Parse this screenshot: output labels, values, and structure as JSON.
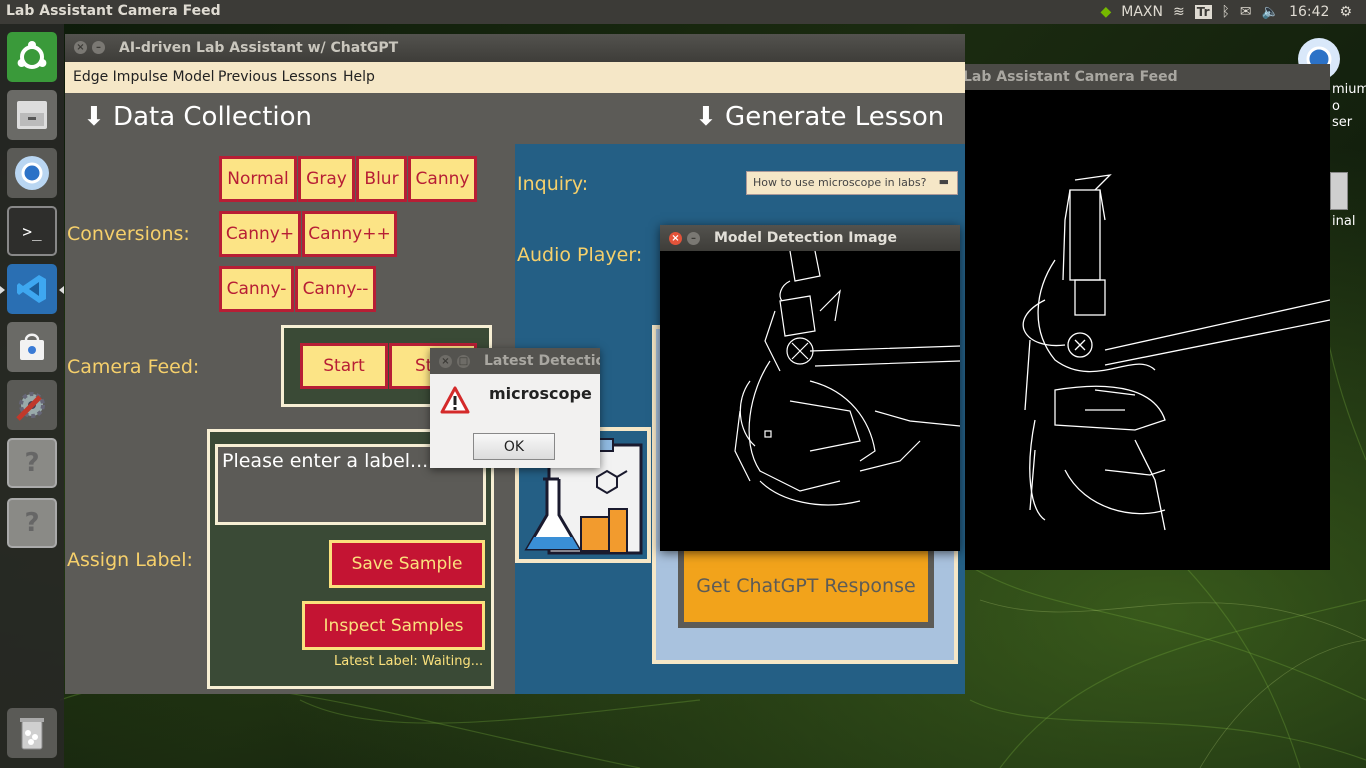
{
  "topbar": {
    "title": "Lab Assistant Camera Feed",
    "tray": {
      "user": "MAXN",
      "keyboard": "Tr",
      "time": "16:42"
    }
  },
  "desktop": {
    "partial_labels": [
      "mium",
      "o",
      "ser",
      "inal"
    ]
  },
  "camera_window": {
    "title": "Lab Assistant Camera Feed"
  },
  "main_window": {
    "title": "AI-driven Lab Assistant w/ ChatGPT",
    "menu": [
      "Edge Impulse Model",
      "Previous Lessons",
      "Help"
    ],
    "data_collection": {
      "heading": "⬇ Data Collection",
      "conversions_label": "Conversions:",
      "conversions": [
        "Normal",
        "Gray",
        "Blur",
        "Canny",
        "Canny+",
        "Canny++",
        "Canny-",
        "Canny--"
      ],
      "camera_feed_label": "Camera Feed:",
      "start_label": "Start",
      "stop_label": "St",
      "assign_label": "Assign Label:",
      "label_input": "Please enter a label...",
      "save_sample": "Save Sample",
      "inspect_samples": "Inspect Samples",
      "latest_label": "Latest Label: Waiting..."
    },
    "generate_lesson": {
      "heading": "⬇ Generate Lesson",
      "inquiry_label": "Inquiry:",
      "inquiry_value": "How to use microscope in labs?",
      "audio_label": "Audio Player:",
      "get_response": "Get ChatGPT Response"
    }
  },
  "popup": {
    "title": "Latest Detection",
    "message": "microscope",
    "ok": "OK"
  },
  "detection_window": {
    "title": "Model Detection Image"
  },
  "colors": {
    "accent_yellow": "#fce486",
    "accent_red": "#b71e35",
    "panel_blue": "#245f85",
    "panel_green": "#3a4a36",
    "orange_button": "#f2a31b"
  }
}
